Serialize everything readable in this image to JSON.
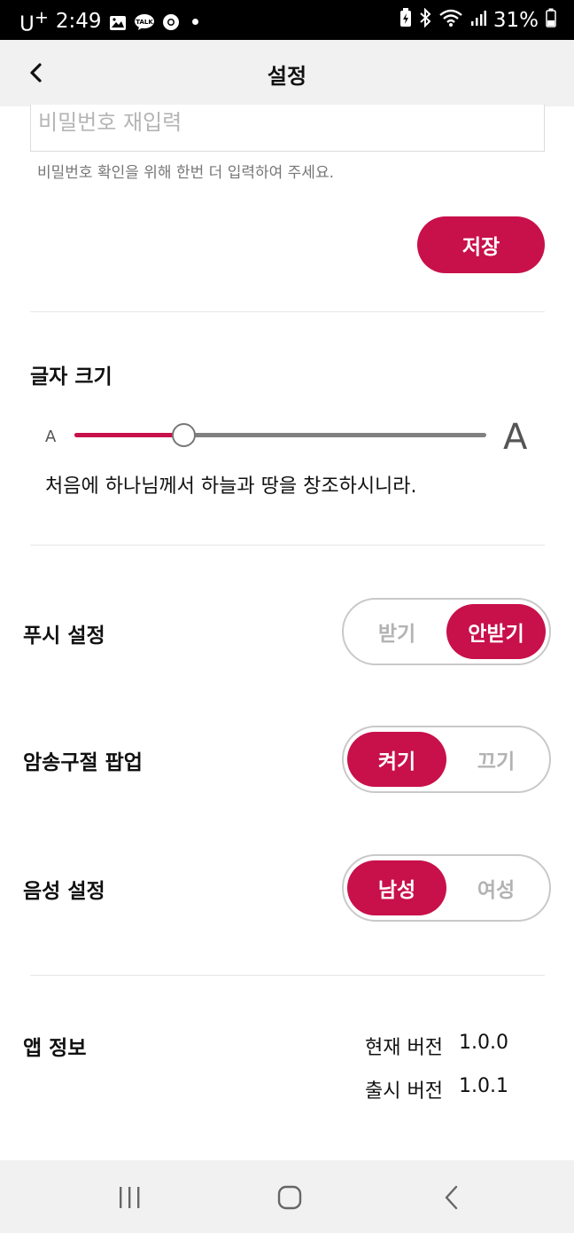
{
  "status_bar": {
    "carrier": "U",
    "carrier_sup": "+",
    "time": "2:49",
    "notif_talk": "TALK",
    "battery": "31%"
  },
  "header": {
    "title": "설정"
  },
  "password": {
    "confirm_placeholder": "비밀번호 재입력",
    "hint": "비밀번호 확인을 위해 한번 더 입력하여 주세요.",
    "save_label": "저장"
  },
  "font_size": {
    "title": "글자 크기",
    "small_label": "A",
    "large_label": "A",
    "level": 0.265,
    "preview": "처음에 하나님께서 하늘과 땅을 창조하시니라."
  },
  "push": {
    "label": "푸시 설정",
    "options": [
      "받기",
      "안받기"
    ],
    "selected": "안받기"
  },
  "memory_popup": {
    "label": "암송구절 팝업",
    "options": [
      "켜기",
      "끄기"
    ],
    "selected": "켜기"
  },
  "voice": {
    "label": "음성 설정",
    "options": [
      "남성",
      "여성"
    ],
    "selected": "남성"
  },
  "app_info": {
    "label": "앱 정보",
    "current_version_label": "현재 버전",
    "current_version": "1.0.0",
    "release_version_label": "출시 버전",
    "release_version": "1.0.1"
  },
  "colors": {
    "accent": "#c8104a",
    "header_bg": "#f1f1f1"
  }
}
